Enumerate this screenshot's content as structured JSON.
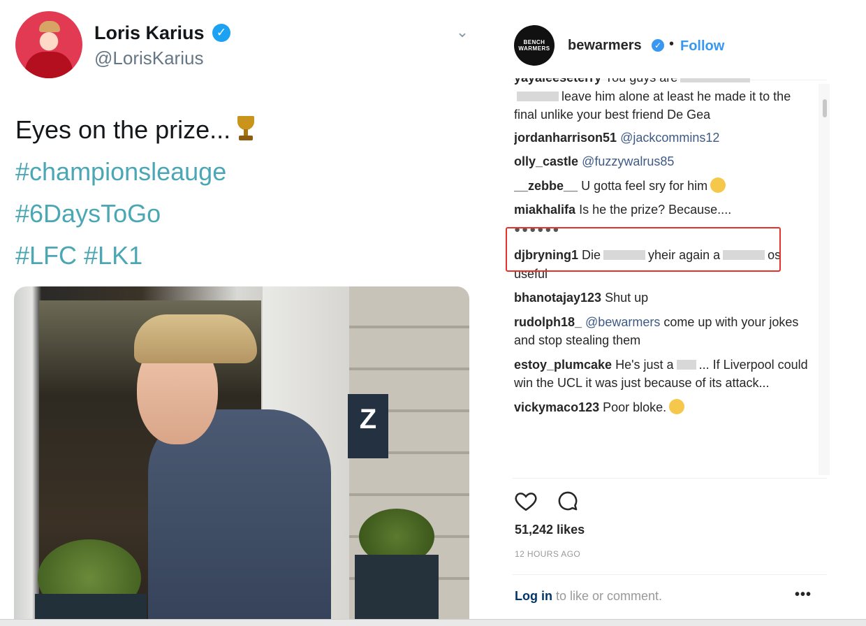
{
  "tweet": {
    "author_name": "Loris Karius",
    "handle": "@LorisKarius",
    "lines": [
      "Eyes on the prize...",
      "#championsleauge",
      "#6DaysToGo",
      "#LFC #LK1"
    ],
    "trophy_icon": "trophy-icon",
    "photo_sign": "Z",
    "hashtag_color": "#4aa7b3",
    "verified_color": "#1da1f2"
  },
  "instagram": {
    "username": "bewarmers",
    "avatar_text": "BENCH WARMERS",
    "separator": "•",
    "follow_label": "Follow",
    "comments": [
      {
        "user": "yayaleeseterry",
        "text": "You guys are"
      },
      {
        "text": "leave him alone at least he made it to the final unlike your best friend De Gea"
      },
      {
        "user": "jordanharrison51",
        "mention": "@jackcommins12"
      },
      {
        "user": "olly_castle",
        "mention": "@fuzzywalrus85"
      },
      {
        "user": "__zebbe__",
        "text": "U gotta feel sry for him"
      },
      {
        "user": "miakhalifa",
        "text": "Is he the prize? Because....",
        "dots": "●●●●●●"
      },
      {
        "user": "djbryning1",
        "text_a": "Die",
        "text_b": "yheir again a",
        "text_c": "os useful"
      },
      {
        "user": "bhanotajay123",
        "text": "Shut up"
      },
      {
        "user": "rudolph18_",
        "mention": "@bewarmers",
        "text": "come up with your jokes and stop stealing them"
      },
      {
        "user": "estoy_plumcake",
        "text_a": "He's just a",
        "text_b": "... If Liverpool could win the UCL it was just because of its attack..."
      },
      {
        "user": "vickymaco123",
        "text": "Poor bloke."
      }
    ],
    "likes": "51,242 likes",
    "time_ago": "12 HOURS AGO",
    "login_link": "Log in",
    "login_text": "to like or comment.",
    "more_icon": "•••",
    "follow_color": "#3897f0",
    "highlight_color": "#e5322b"
  }
}
